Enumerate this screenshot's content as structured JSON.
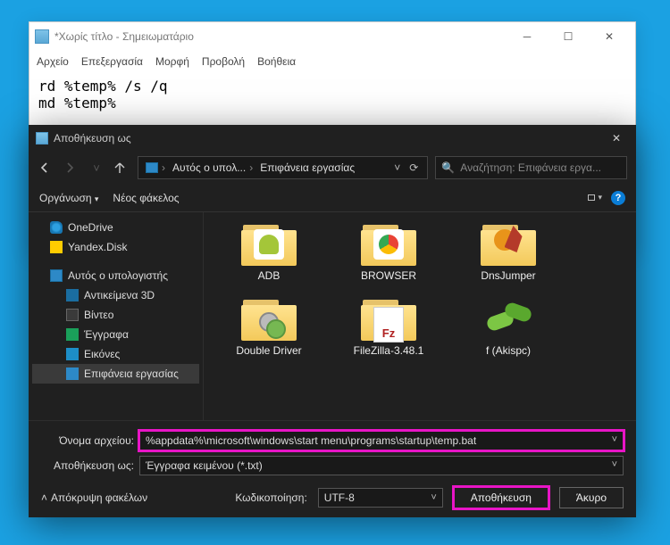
{
  "notepad": {
    "title": "*Χωρίς τίτλο - Σημειωματάριο",
    "menu": {
      "file": "Αρχείο",
      "edit": "Επεξεργασία",
      "format": "Μορφή",
      "view": "Προβολή",
      "help": "Βοήθεια"
    },
    "content": "rd %temp% /s /q\nmd %temp%"
  },
  "saveas": {
    "title": "Αποθήκευση ως",
    "address": {
      "seg1": "Αυτός ο υπολ...",
      "seg2": "Επιφάνεια εργασίας"
    },
    "search_placeholder": "Αναζήτηση: Επιφάνεια εργα...",
    "toolbar": {
      "organize": "Οργάνωση",
      "new_folder": "Νέος φάκελος"
    },
    "sidebar": {
      "onedrive": "OneDrive",
      "yandex": "Yandex.Disk",
      "thispc": "Αυτός ο υπολογιστής",
      "objects3d": "Αντικείμενα 3D",
      "video": "Βίντεο",
      "documents": "Έγγραφα",
      "pictures": "Εικόνες",
      "desktop": "Επιφάνεια εργασίας"
    },
    "files": {
      "r0c0": "ADB",
      "r0c1": "BROWSER",
      "r0c2": "DnsJumper",
      "r1c0": "Double Driver",
      "r1c1": "FileZilla-3.48.1",
      "r1c2": "f (Akispc)"
    },
    "form": {
      "filename_label": "Όνομα αρχείου:",
      "filename_value": "%appdata%\\microsoft\\windows\\start menu\\programs\\startup\\temp.bat",
      "savetype_label": "Αποθήκευση ως:",
      "savetype_value": "Έγγραφα κειμένου (*.txt)"
    },
    "actions": {
      "hide_folders": "Απόκρυψη φακέλων",
      "encoding_label": "Κωδικοποίηση:",
      "encoding_value": "UTF-8",
      "save": "Αποθήκευση",
      "cancel": "Άκυρο"
    }
  }
}
